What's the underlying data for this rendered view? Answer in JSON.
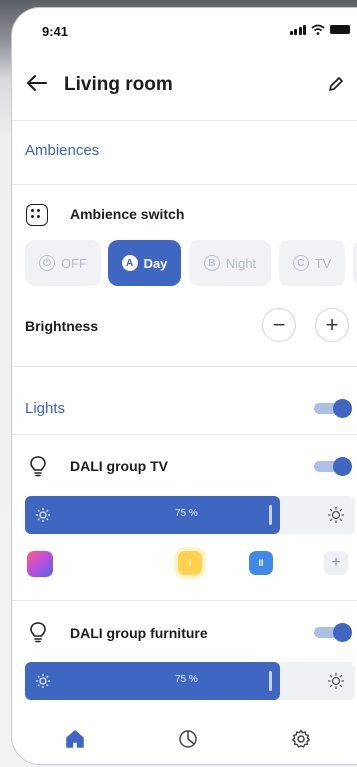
{
  "status_bar": {
    "time": "9:41"
  },
  "header": {
    "back_icon": "arrow-left-icon",
    "title": "Living room",
    "edit_icon": "pencil-icon"
  },
  "ambiences": {
    "section_title": "Ambiences",
    "switch_label": "Ambience switch",
    "switch_icon": "switch-dots-icon",
    "chips": [
      {
        "glyph": "⏻",
        "label": "OFF",
        "active": false
      },
      {
        "glyph": "A",
        "label": "Day",
        "active": true
      },
      {
        "glyph": "B",
        "label": "Night",
        "active": false
      },
      {
        "glyph": "C",
        "label": "TV",
        "active": false
      }
    ],
    "brightness_label": "Brightness",
    "decrease_glyph": "−",
    "increase_glyph": "+"
  },
  "lights": {
    "section_title": "Lights",
    "master_on": true,
    "groups": [
      {
        "name": "DALI group TV",
        "on": true,
        "level_percent": 75,
        "level_label": "75 %",
        "scene_yellow_glyph": "I",
        "scene_blue_glyph": "II",
        "add_glyph": "+"
      },
      {
        "name": "DALI group furniture",
        "on": true,
        "level_percent": 75,
        "level_label": "75 %"
      }
    ]
  },
  "bottom_nav": {
    "items": [
      {
        "icon": "home-icon",
        "active": true
      },
      {
        "icon": "chart-pie-icon",
        "active": false
      },
      {
        "icon": "settings-gear-icon",
        "active": false
      }
    ]
  },
  "colors": {
    "accent": "#3f66c1",
    "accent_light": "#aebfe6",
    "section_title": "#3b63c1"
  }
}
